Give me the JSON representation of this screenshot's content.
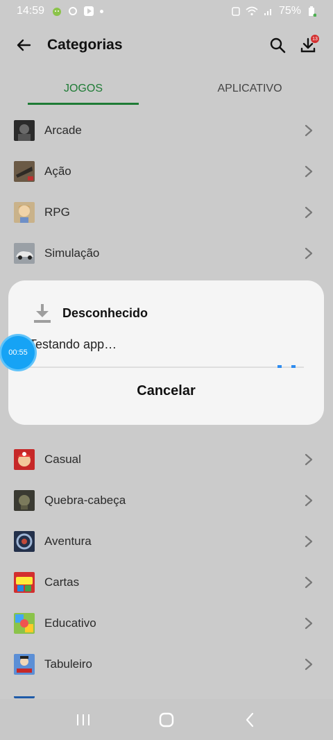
{
  "status_bar": {
    "time": "14:59",
    "battery": "75%"
  },
  "header": {
    "title": "Categorias"
  },
  "tabs": [
    {
      "label": "JOGOS"
    },
    {
      "label": "APLICATIVO"
    }
  ],
  "badge_count": "13",
  "categories": [
    {
      "label": "Arcade"
    },
    {
      "label": "Ação"
    },
    {
      "label": "RPG"
    },
    {
      "label": "Simulação"
    },
    {
      "label": "Casual"
    },
    {
      "label": "Quebra-cabeça"
    },
    {
      "label": "Aventura"
    },
    {
      "label": "Cartas"
    },
    {
      "label": "Educativo"
    },
    {
      "label": "Tabuleiro"
    }
  ],
  "dialog": {
    "title": "Desconhecido",
    "message": "Testando app…",
    "cancel_label": "Cancelar"
  },
  "timer": {
    "label": "00:55"
  },
  "colors": {
    "accent": "#1e7b35",
    "timer": "#16a3f5",
    "badge": "#d32f2f"
  }
}
